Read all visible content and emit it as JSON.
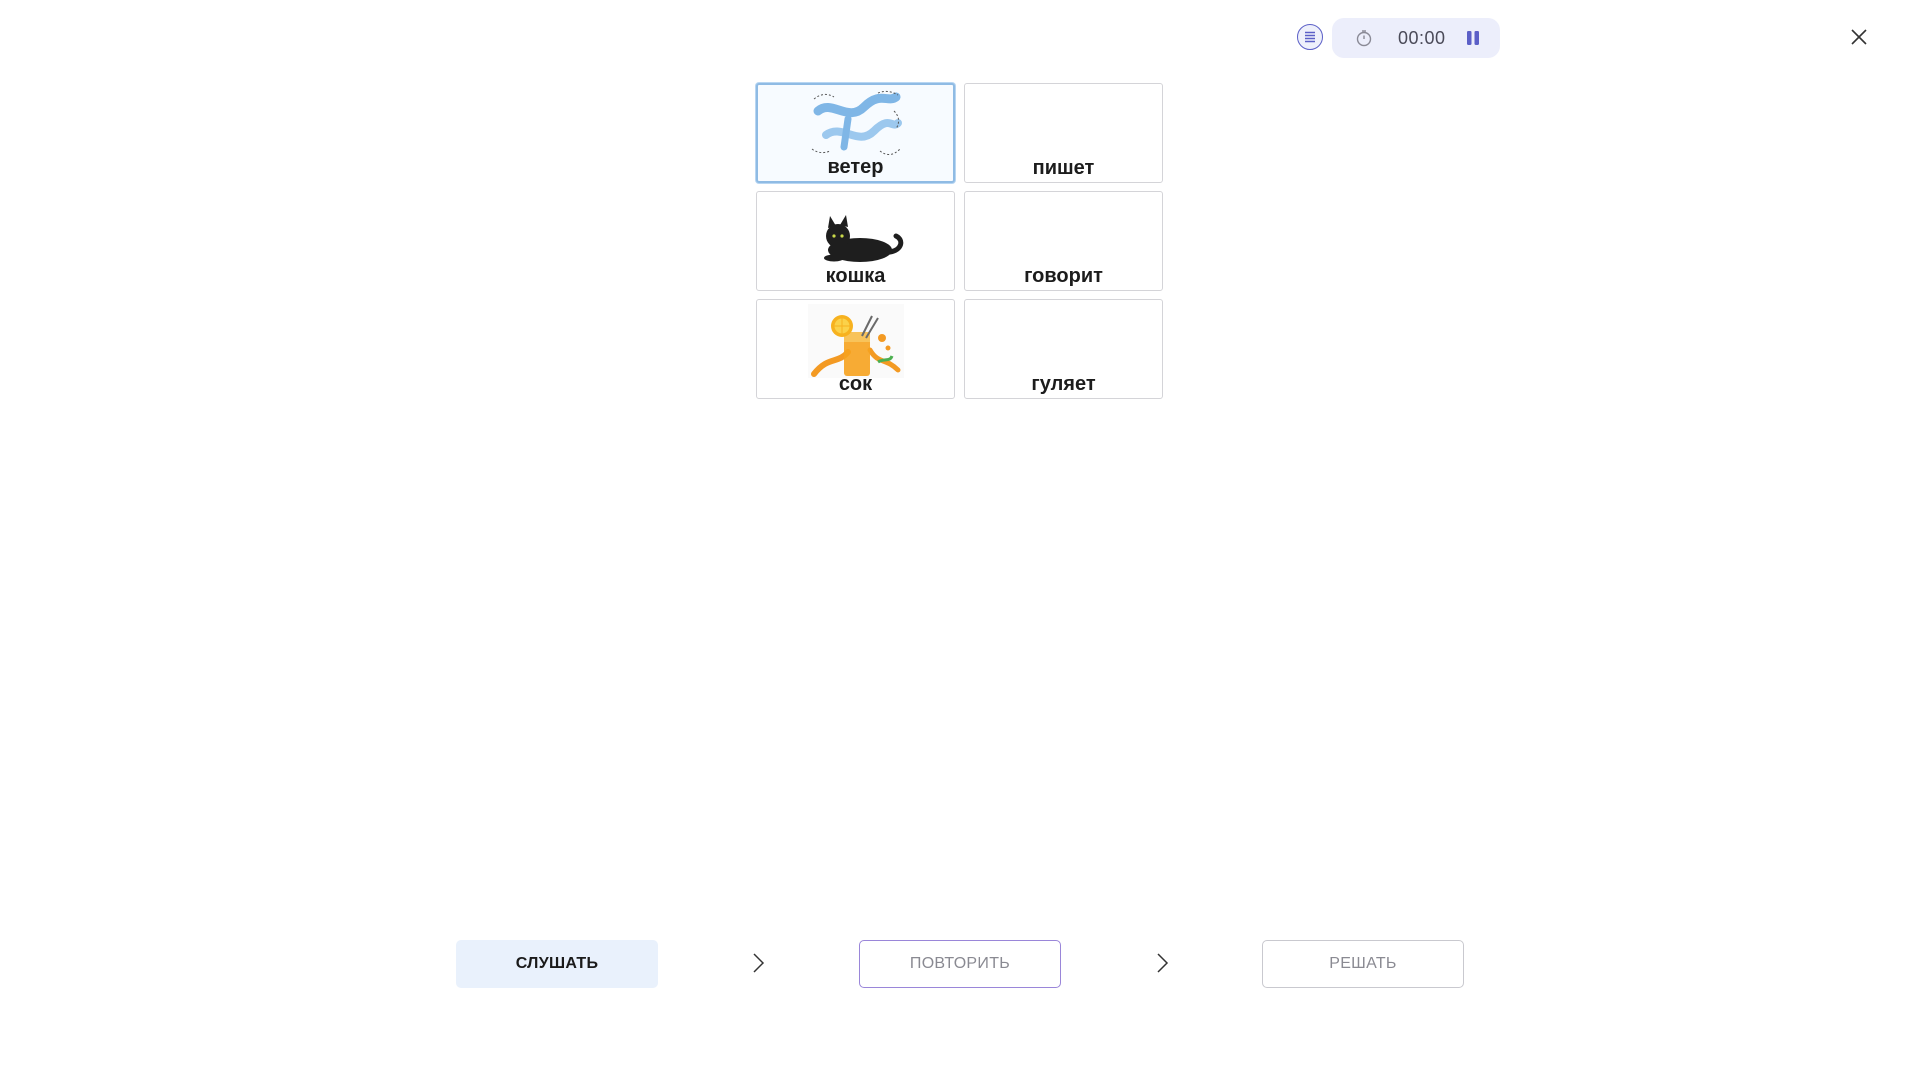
{
  "header": {
    "menu_icon": "list-icon",
    "clock_icon": "stopwatch-icon",
    "timer": "00:00",
    "pause_icon": "pause-icon",
    "close_icon": "close-icon",
    "accent_color": "#5b5fc7"
  },
  "cards": [
    {
      "word": "ветер",
      "picture": "wind-picture",
      "selected": true
    },
    {
      "word": "пишет",
      "picture": null,
      "selected": false
    },
    {
      "word": "кошка",
      "picture": "cat-picture",
      "selected": false
    },
    {
      "word": "говорит",
      "picture": null,
      "selected": false
    },
    {
      "word": "сок",
      "picture": "juice-picture",
      "selected": false
    },
    {
      "word": "гуляет",
      "picture": null,
      "selected": false
    }
  ],
  "steps": {
    "listen": "СЛУШАТЬ",
    "repeat": "ПОВТОРИТЬ",
    "solve": "РЕШАТЬ",
    "arrow_icon": "chevron-right-icon"
  }
}
